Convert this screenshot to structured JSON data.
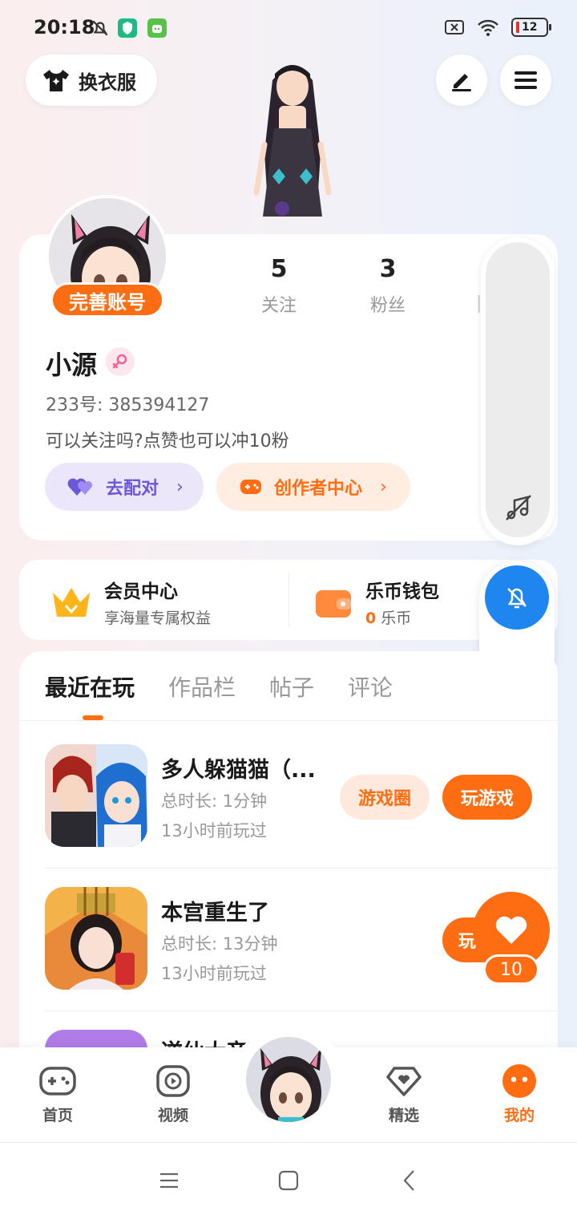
{
  "status_bar": {
    "time": "20:18",
    "battery": "12",
    "icons": [
      "bell-muted-icon",
      "shield-app-icon",
      "robot-app-icon",
      "sim-off-icon",
      "wifi-icon",
      "battery-icon"
    ]
  },
  "header": {
    "dress_label": "换衣服",
    "edit_icon": "pen-icon",
    "menu_icon": "hamburger-icon"
  },
  "profile": {
    "complete_label": "完善账号",
    "stats": [
      {
        "value": "5",
        "label": "关注"
      },
      {
        "value": "3",
        "label": "粉丝"
      }
    ],
    "username": "小源",
    "uid": "233号: 385394127",
    "bio": "可以关注吗?点赞也可以冲10粉",
    "match_label": "去配对",
    "creator_label": "创作者中心"
  },
  "vip": {
    "member_title": "会员中心",
    "member_sub": "享海量专属权益",
    "wallet_title": "乐币钱包",
    "wallet_amount": "0",
    "wallet_unit": "乐币"
  },
  "tabs": [
    "最近在玩",
    "作品栏",
    "帖子",
    "评论"
  ],
  "games": [
    {
      "name": "多人躲猫猫（...",
      "duration": "总时长: 1分钟",
      "last_played": "13小时前玩过",
      "circle_label": "游戏圈",
      "play_label": "玩游戏"
    },
    {
      "name": "本宫重生了",
      "duration": "总时长: 13分钟",
      "last_played": "13小时前玩过",
      "play_label": "玩"
    }
  ],
  "partial_game_name": "逆仙大帝",
  "like": {
    "count": "10"
  },
  "bottom_nav": [
    {
      "label": "首页",
      "icon": "gamepad-icon"
    },
    {
      "label": "视频",
      "icon": "play-icon"
    },
    {
      "label": "精选",
      "icon": "heart-diamond-icon"
    },
    {
      "label": "我的",
      "icon": "face-icon"
    }
  ],
  "colors": {
    "accent": "#ff6d12",
    "purple": "#6b58d6",
    "blue": "#1f86f0"
  }
}
